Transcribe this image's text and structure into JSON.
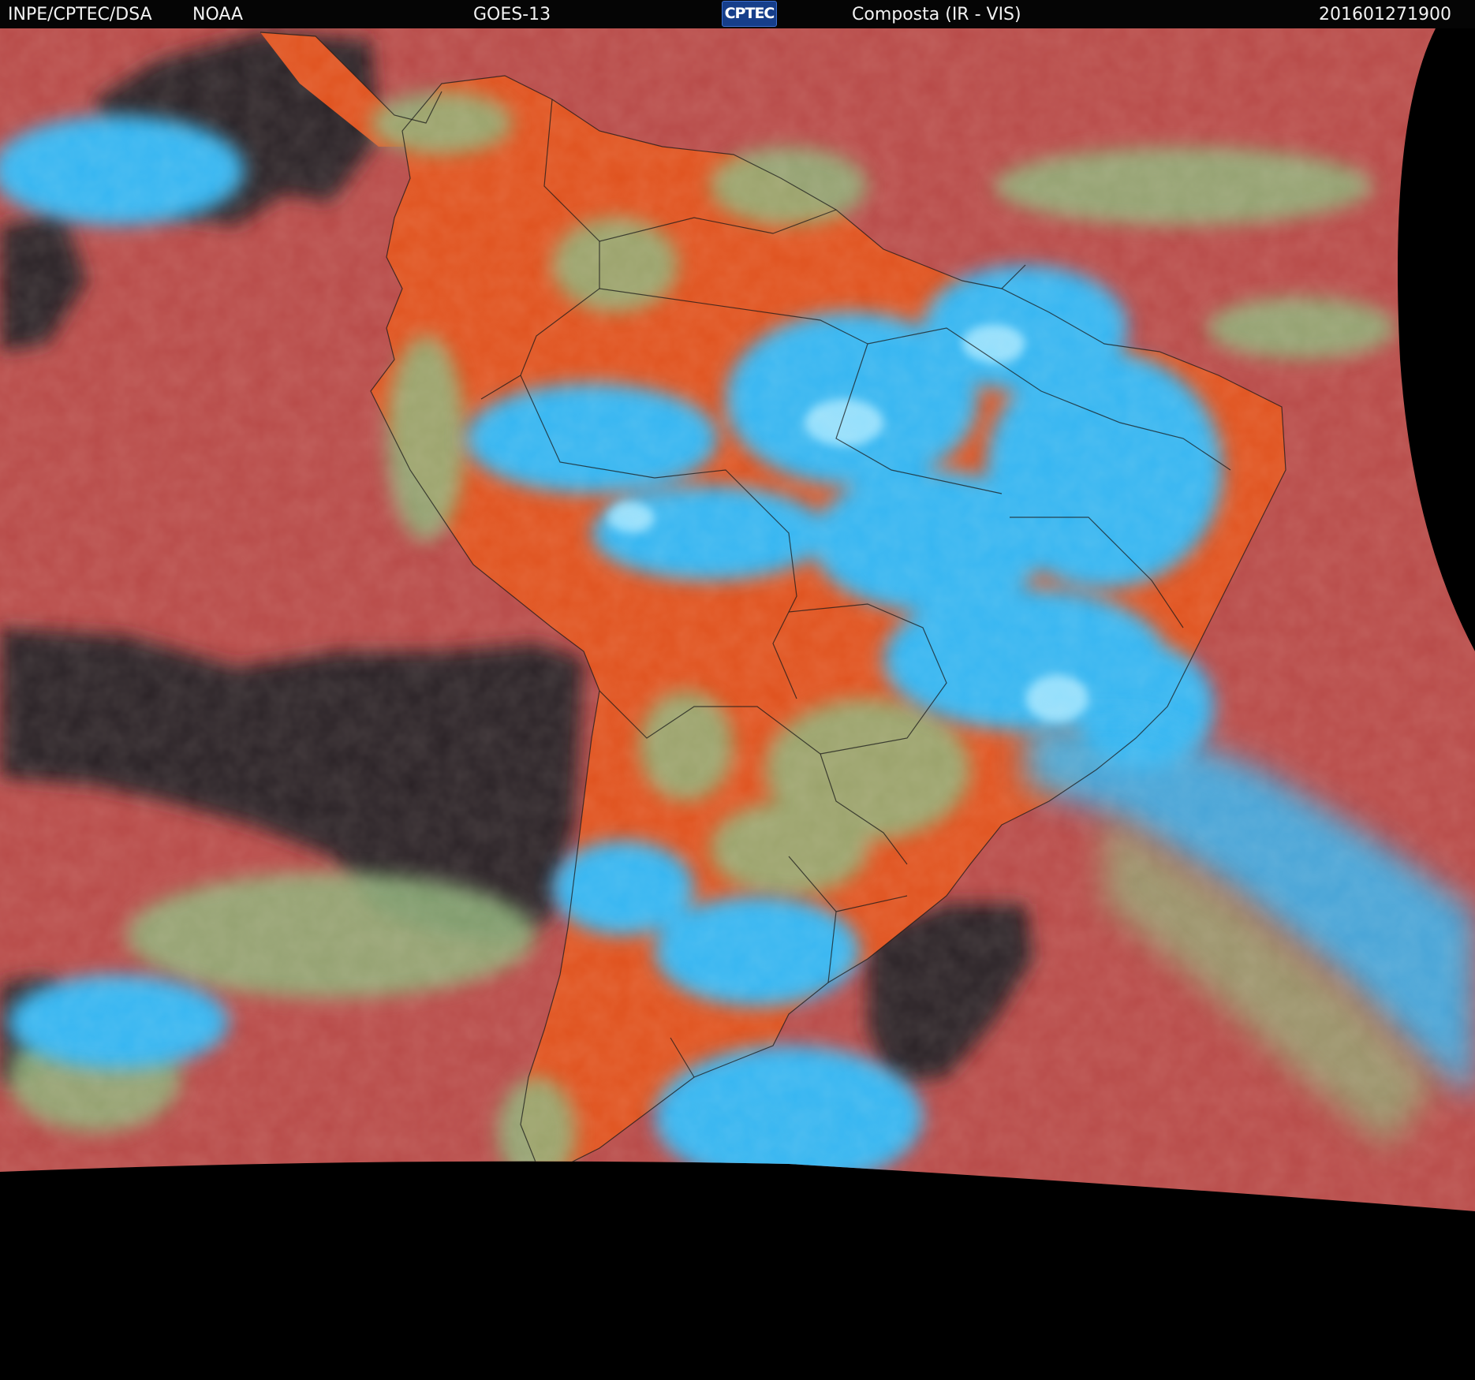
{
  "header": {
    "institution": "INPE/CPTEC/DSA",
    "agency": "NOAA",
    "satellite": "GOES-13",
    "logo_text": "CPTEC",
    "product": "Composta (IR - VIS)",
    "timestamp": "201601271900"
  },
  "palette": {
    "ocean": "#b84a48",
    "land_clear": "#e0521e",
    "high_cloud": "#36b6f2",
    "mid_cloud": "#8fb27a",
    "low_cloud_dark": "#2a2426",
    "no_data": "#000000",
    "header_bg": "#050505",
    "logo_bg": "#163e8a"
  }
}
